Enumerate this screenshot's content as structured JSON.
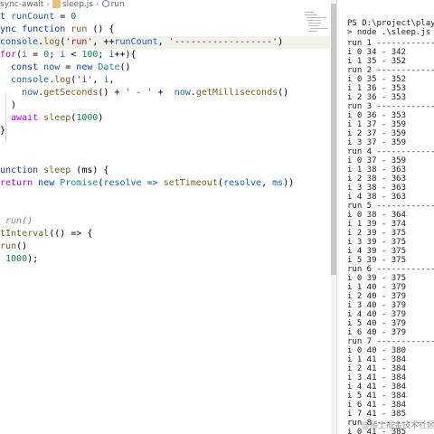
{
  "breadcrumb": {
    "folder": "sync-await",
    "file": "sleep.js",
    "symbol": "run"
  },
  "code": [
    {
      "segs": [
        {
          "t": "t ",
          "c": "kw"
        },
        {
          "t": "runCount",
          "c": "vr"
        },
        {
          "t": " = ",
          "c": "op"
        },
        {
          "t": "0",
          "c": "num"
        }
      ]
    },
    {
      "segs": [
        {
          "t": "ync ",
          "c": "kw"
        },
        {
          "t": "function ",
          "c": "kw"
        },
        {
          "t": "run",
          "c": "fn"
        },
        {
          "t": " () {",
          "c": "op"
        }
      ]
    },
    {
      "segs": [
        {
          "t": "console",
          "c": "vr"
        },
        {
          "t": ".",
          "c": "op"
        },
        {
          "t": "log",
          "c": "fn"
        },
        {
          "t": "(",
          "c": "op"
        },
        {
          "t": "'run'",
          "c": "str"
        },
        {
          "t": ", ++",
          "c": "op"
        },
        {
          "t": "runCount",
          "c": "vr"
        },
        {
          "t": ", ",
          "c": "op"
        },
        {
          "t": "'------------------'",
          "c": "str"
        },
        {
          "t": ")",
          "c": "op"
        }
      ]
    },
    {
      "segs": [
        {
          "t": "for",
          "c": "kw2"
        },
        {
          "t": "(",
          "c": "op"
        },
        {
          "t": "i",
          "c": "vr"
        },
        {
          "t": " = ",
          "c": "op"
        },
        {
          "t": "0",
          "c": "num"
        },
        {
          "t": "; ",
          "c": "op"
        },
        {
          "t": "i",
          "c": "vr"
        },
        {
          "t": " < ",
          "c": "op"
        },
        {
          "t": "100",
          "c": "num"
        },
        {
          "t": "; ",
          "c": "op"
        },
        {
          "t": "i",
          "c": "vr"
        },
        {
          "t": "++){",
          "c": "op"
        }
      ]
    },
    {
      "segs": [
        {
          "t": "  const ",
          "c": "kw"
        },
        {
          "t": "now",
          "c": "vr"
        },
        {
          "t": " = ",
          "c": "op"
        },
        {
          "t": "new ",
          "c": "kw"
        },
        {
          "t": "Date",
          "c": "tl"
        },
        {
          "t": "()",
          "c": "op"
        }
      ]
    },
    {
      "segs": [
        {
          "t": "  console",
          "c": "vr"
        },
        {
          "t": ".",
          "c": "op"
        },
        {
          "t": "log",
          "c": "fn"
        },
        {
          "t": "(",
          "c": "op"
        },
        {
          "t": "'i'",
          "c": "str"
        },
        {
          "t": ", ",
          "c": "op"
        },
        {
          "t": "i",
          "c": "vr"
        },
        {
          "t": ",",
          "c": "op"
        }
      ]
    },
    {
      "segs": [
        {
          "t": "    now",
          "c": "vr"
        },
        {
          "t": ".",
          "c": "op"
        },
        {
          "t": "getSeconds",
          "c": "fn"
        },
        {
          "t": "() + ",
          "c": "op"
        },
        {
          "t": "' - '",
          "c": "str"
        },
        {
          "t": " +  ",
          "c": "op"
        },
        {
          "t": "now",
          "c": "vr"
        },
        {
          "t": ".",
          "c": "op"
        },
        {
          "t": "getMilliseconds",
          "c": "fn"
        },
        {
          "t": "()",
          "c": "op"
        }
      ]
    },
    {
      "segs": [
        {
          "t": "  )",
          "c": "op"
        }
      ]
    },
    {
      "segs": [
        {
          "t": "  await ",
          "c": "kw2"
        },
        {
          "t": "sleep",
          "c": "fn"
        },
        {
          "t": "(",
          "c": "op"
        },
        {
          "t": "1000",
          "c": "num"
        },
        {
          "t": ")",
          "c": "op"
        }
      ]
    },
    {
      "segs": [
        {
          "t": "}",
          "c": "op"
        }
      ]
    },
    {
      "segs": []
    },
    {
      "segs": []
    },
    {
      "segs": [
        {
          "t": "unction ",
          "c": "kw"
        },
        {
          "t": "sleep",
          "c": "fn"
        },
        {
          "t": " (ms) {",
          "c": "op"
        }
      ]
    },
    {
      "segs": [
        {
          "t": "return ",
          "c": "kw2"
        },
        {
          "t": "new ",
          "c": "kw"
        },
        {
          "t": "Promise",
          "c": "tl"
        },
        {
          "t": "(",
          "c": "op"
        },
        {
          "t": "resolve",
          "c": "vr"
        },
        {
          "t": " => ",
          "c": "kw"
        },
        {
          "t": "setTimeout",
          "c": "fn"
        },
        {
          "t": "(",
          "c": "op"
        },
        {
          "t": "resolve",
          "c": "vr"
        },
        {
          "t": ", ",
          "c": "op"
        },
        {
          "t": "ms",
          "c": "vr"
        },
        {
          "t": "))",
          "c": "op"
        }
      ]
    },
    {
      "segs": []
    },
    {
      "segs": []
    },
    {
      "segs": [
        {
          "t": " run()",
          "c": "cm"
        }
      ]
    },
    {
      "segs": [
        {
          "t": "tInterval",
          "c": "fn"
        },
        {
          "t": "(() => {",
          "c": "op"
        }
      ]
    },
    {
      "segs": [
        {
          "t": "run",
          "c": "fn"
        },
        {
          "t": "()",
          "c": "op"
        }
      ]
    },
    {
      "segs": [
        {
          "t": " 1000",
          "c": "num"
        },
        {
          "t": ");",
          "c": "op"
        }
      ]
    }
  ],
  "terminal": {
    "prompt": "PS D:\\project\\playgrou",
    "command": "> node .\\sleep.js",
    "lines": [
      "run 1 ------------------",
      "i 0 34 - 342",
      "i 1 35 - 352",
      "run 2 ------------------",
      "i 0 35 - 352",
      "i 1 36 - 353",
      "i 2 36 - 353",
      "run 3 ------------------",
      "i 0 36 - 353",
      "i 1 37 - 359",
      "i 2 37 - 359",
      "i 3 37 - 359",
      "run 4 ------------------",
      "i 0 37 - 359",
      "i 1 38 - 363",
      "i 2 38 - 363",
      "i 3 38 - 363",
      "i 4 38 - 363",
      "run 5 ------------------",
      "i 0 38 - 364",
      "i 1 39 - 374",
      "i 2 39 - 375",
      "i 3 39 - 375",
      "i 4 39 - 375",
      "i 5 39 - 375",
      "run 6 ------------------",
      "i 0 39 - 375",
      "i 1 40 - 379",
      "i 2 40 - 379",
      "i 3 40 - 379",
      "i 4 40 - 379",
      "i 5 40 - 379",
      "i 6 40 - 379",
      "run 7 ------------------",
      "i 0 40 - 380",
      "i 1 41 - 384",
      "i 2 41 - 384",
      "i 3 41 - 384",
      "i 4 41 - 384",
      "i 5 41 - 384",
      "i 6 41 - 384",
      "i 7 41 - 385",
      "run 8 ------------------",
      "i 0 41 - 385"
    ]
  },
  "watermark": "@稀土掘金技术社区"
}
